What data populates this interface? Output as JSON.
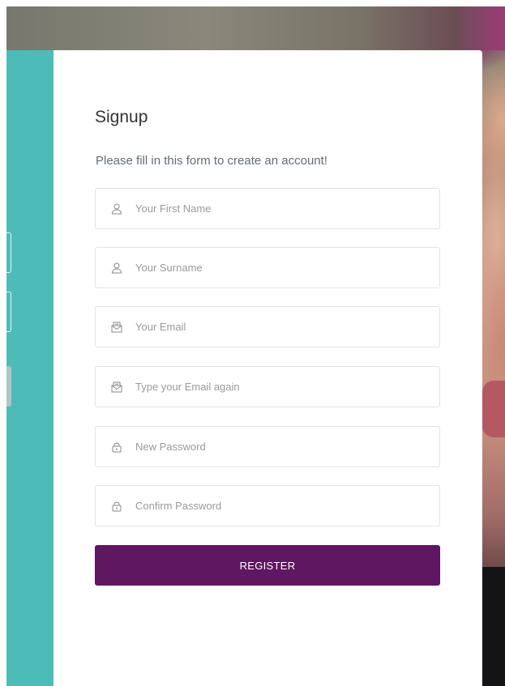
{
  "form": {
    "title": "Signup",
    "subtitle": "Please fill in this form to create an account!",
    "fields": [
      {
        "placeholder": "Your First Name",
        "value": "",
        "icon": "user-icon"
      },
      {
        "placeholder": "Your Surname",
        "value": "",
        "icon": "user-icon"
      },
      {
        "placeholder": "Your Email",
        "value": "",
        "icon": "mail-icon"
      },
      {
        "placeholder": "Type your Email again",
        "value": "",
        "icon": "mail-icon"
      },
      {
        "placeholder": "New Password",
        "value": "",
        "icon": "lock-icon"
      },
      {
        "placeholder": "Confirm Password",
        "value": "",
        "icon": "lock-icon"
      }
    ],
    "submit_label": "REGISTER"
  },
  "colors": {
    "side_panel": "#4dbcb8",
    "button": "#5e1760",
    "text": "#333333",
    "placeholder": "#9a9a9a",
    "border": "#e3e3e3"
  }
}
